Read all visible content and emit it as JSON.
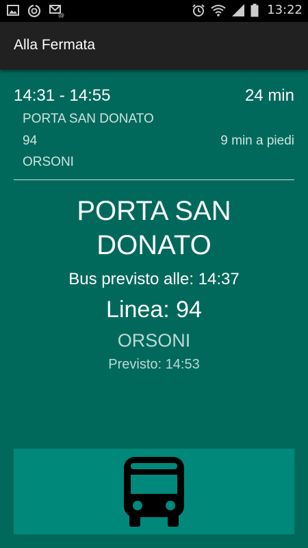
{
  "status_bar": {
    "time": "13:22",
    "icons": [
      "image-icon",
      "sync-icon",
      "mail-icon",
      "alarm-icon",
      "wifi-icon",
      "signal-icon",
      "battery-icon"
    ]
  },
  "app_bar": {
    "title": "Alla Fermata"
  },
  "summary": {
    "time_range": "14:31 - 14:55",
    "duration": "24 min",
    "stop": "PORTA SAN DONATO",
    "line": "94",
    "walk": "9 min a piedi",
    "destination": "ORSONI"
  },
  "detail": {
    "stop_line1": "PORTA SAN",
    "stop_line2": "DONATO",
    "bus_expected": "Bus previsto alle: 14:37",
    "line": "Linea: 94",
    "destination": "ORSONI",
    "forecast": "Previsto: 14:53"
  },
  "action": {
    "icon": "bus-icon"
  },
  "colors": {
    "background": "#00695c",
    "app_bar": "#212121",
    "button": "#00897b",
    "icon": "#000000"
  }
}
